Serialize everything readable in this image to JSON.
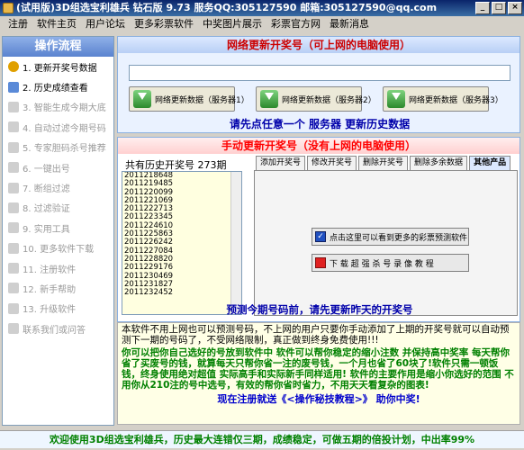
{
  "window": {
    "title": "(试用版)3D组选宝利雄兵 钻石版  9.73 服务QQ:305127590 邮箱:305127590@qq.com"
  },
  "menu": [
    "注册",
    "软件主页",
    "用户论坛",
    "更多彩票软件",
    "中奖图片展示",
    "彩票官方网",
    "最新消息"
  ],
  "sidebar": {
    "title": "操作流程",
    "items": [
      {
        "label": "1. 更新开奖号数据",
        "icon": "arrow-down-icon",
        "active": true
      },
      {
        "label": "2. 历史成绩查看",
        "icon": "pencil-icon",
        "active": true
      },
      {
        "label": "3. 智能生成今期大底",
        "icon": "wand-icon",
        "active": false
      },
      {
        "label": "4. 自动过滤今期号码",
        "icon": "filter-icon",
        "active": false
      },
      {
        "label": "5. 专家胆码杀号推荐",
        "icon": "expert-icon",
        "active": false
      },
      {
        "label": "6. 一键出号",
        "icon": "key-icon",
        "active": false
      },
      {
        "label": "7. 断组过滤",
        "icon": "split-icon",
        "active": false
      },
      {
        "label": "8. 过滤验证",
        "icon": "check-icon",
        "active": false
      },
      {
        "label": "9. 实用工具",
        "icon": "tool-icon",
        "active": false
      },
      {
        "label": "10. 更多软件下载",
        "icon": "download-icon",
        "active": false
      },
      {
        "label": "11. 注册软件",
        "icon": "register-icon",
        "active": false
      },
      {
        "label": "12. 新手帮助",
        "icon": "help-icon",
        "active": false
      },
      {
        "label": "13. 升级软件",
        "icon": "upgrade-icon",
        "active": false
      },
      {
        "label": "联系我们或问答",
        "icon": "contact-icon",
        "active": false
      }
    ]
  },
  "update_panel": {
    "title": "网络更新开奖号（可上网的电脑使用）",
    "url_value": "",
    "buttons": [
      "网络更新数据（服务器1）",
      "网络更新数据（服务器2）",
      "网络更新数据（服务器3）"
    ],
    "note": "请先点任意一个 服务器 更新历史数据"
  },
  "manual_panel": {
    "title": "手动更新开奖号（没有上网的电脑使用）",
    "history_label": "共有历史开奖号  273期",
    "numbers": [
      "2011218648",
      "2011219485",
      "2011220099",
      "2011221069",
      "2011222713",
      "2011223345",
      "2011224610",
      "2011225863",
      "2011226242",
      "2011227084",
      "2011228820",
      "2011229176",
      "2011230469",
      "2011231827",
      "2011232452"
    ],
    "tabs": [
      "添加开奖号",
      "修改开奖号",
      "删除开奖号",
      "删除多余数据",
      "其他产品"
    ],
    "selected_tab": "其他产品",
    "product_buttons": [
      "点击这里可以看到更多的彩票预测软件",
      "下 载 超 强 杀 号 录 像 教 程"
    ],
    "note": "预测今期号码前，请先更新昨天的开奖号"
  },
  "info": {
    "para1": "本软件不用上网也可以预测号码，不上网的用户只要你手动添加了上期的开奖号就可以自动预测下一期的号码了，不受网络限制，真正做到终身免费使用!!!",
    "para2": "你可以把你自己选好的号放到软件中 软件可以帮你稳定的缩小注数 并保持高中奖率  每天帮你省了买废号的钱，就算每天只帮你省一注的废号钱，一个月也省了60块了!软件只需一顿饭钱，终身使用绝对超值 实际高手和实际新手同样适用!   软件的主要作用是缩小你选好的范围 不用你从210注的号中选号，有效的帮你省时省力，不用天天看复杂的图表!",
    "para3": "现在注册就送《<操作秘技教程>》 助你中奖!"
  },
  "footer": "欢迎使用3D组选宝利雄兵，历史最大连错仅三期，成绩稳定，可做五期的倍投计划，中出率99%"
}
